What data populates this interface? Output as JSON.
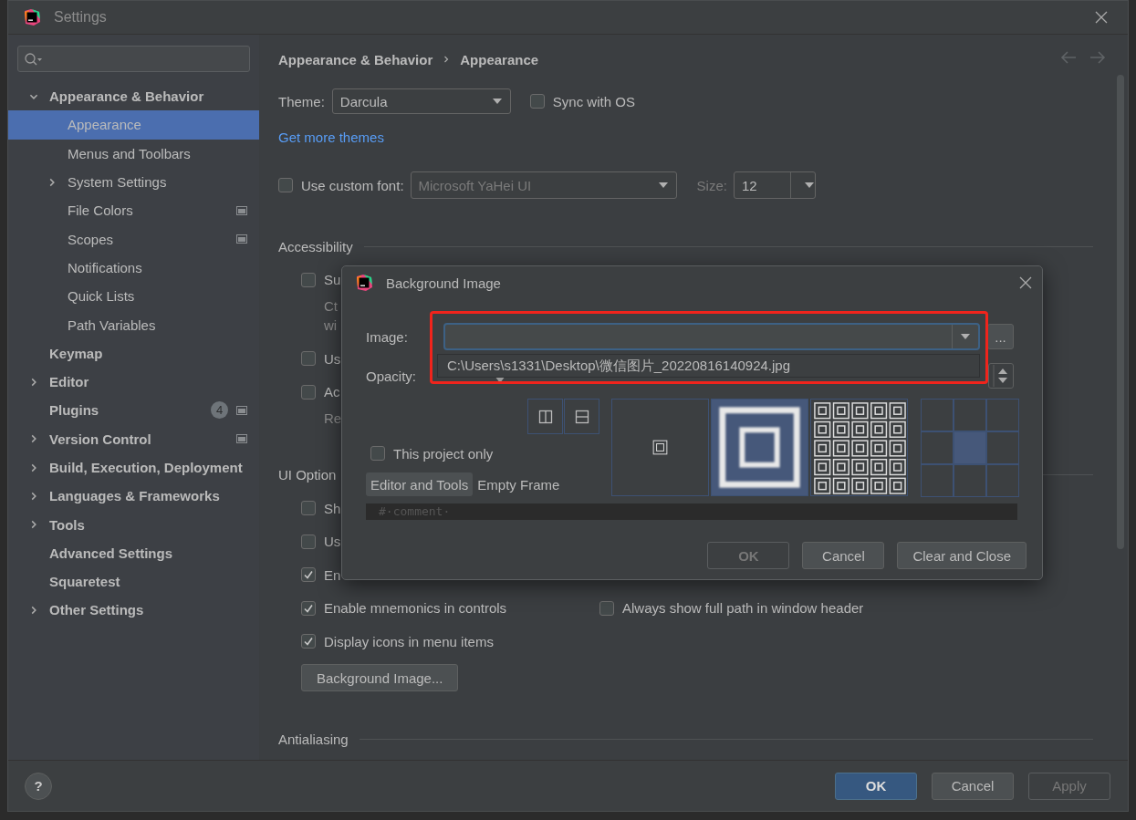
{
  "window": {
    "title": "Settings"
  },
  "sidebar": {
    "items": [
      {
        "label": "Appearance & Behavior",
        "expanded": true,
        "selected": false,
        "project_icon": false,
        "children": [
          {
            "label": "Appearance",
            "selected": true,
            "project_icon": false
          },
          {
            "label": "Menus and Toolbars",
            "selected": false,
            "project_icon": false
          },
          {
            "label": "System Settings",
            "expanded": false,
            "selected": false,
            "project_icon": false
          },
          {
            "label": "File Colors",
            "selected": false,
            "project_icon": true
          },
          {
            "label": "Scopes",
            "selected": false,
            "project_icon": true
          },
          {
            "label": "Notifications",
            "selected": false,
            "project_icon": false
          },
          {
            "label": "Quick Lists",
            "selected": false,
            "project_icon": false
          },
          {
            "label": "Path Variables",
            "selected": false,
            "project_icon": false
          }
        ]
      },
      {
        "label": "Keymap",
        "selected": false,
        "project_icon": false
      },
      {
        "label": "Editor",
        "expanded": false,
        "selected": false,
        "project_icon": false
      },
      {
        "label": "Plugins",
        "selected": false,
        "project_icon": true,
        "badge": "4"
      },
      {
        "label": "Version Control",
        "expanded": false,
        "selected": false,
        "project_icon": true
      },
      {
        "label": "Build, Execution, Deployment",
        "expanded": false,
        "selected": false,
        "project_icon": false
      },
      {
        "label": "Languages & Frameworks",
        "expanded": false,
        "selected": false,
        "project_icon": false
      },
      {
        "label": "Tools",
        "expanded": false,
        "selected": false,
        "project_icon": false
      },
      {
        "label": "Advanced Settings",
        "selected": false,
        "project_icon": false
      },
      {
        "label": "Squaretest",
        "selected": false,
        "project_icon": false
      },
      {
        "label": "Other Settings",
        "expanded": false,
        "selected": false,
        "project_icon": false
      }
    ]
  },
  "breadcrumb": [
    "Appearance & Behavior",
    "Appearance"
  ],
  "theme": {
    "label": "Theme:",
    "value": "Darcula"
  },
  "sync_with_os": {
    "label": "Sync with OS",
    "checked": false
  },
  "more_themes_link": "Get more themes",
  "custom_font": {
    "label": "Use custom font:",
    "checked": false,
    "value": "Microsoft YaHei UI",
    "disabled": true,
    "size_label": "Size:",
    "size": "12"
  },
  "sections": [
    {
      "title": "Accessibility",
      "options": [
        {
          "label": "Su",
          "checked": false,
          "notes": [
            "Ct",
            "wi"
          ]
        },
        {
          "label": "Us",
          "checked": false
        },
        {
          "label": "Ac",
          "checked": false,
          "notes": [
            "Re"
          ]
        }
      ]
    },
    {
      "title": "UI Option",
      "options": [
        {
          "label": "Sh",
          "checked": false
        },
        {
          "label": "Us",
          "checked": false
        },
        {
          "label": "En",
          "checked": true
        },
        {
          "label": "Enable mnemonics in controls",
          "checked": true,
          "side": {
            "label": "Always show full path in window header",
            "checked": false
          }
        },
        {
          "label": "Display icons in menu items",
          "checked": true
        }
      ],
      "button": "Background Image..."
    },
    {
      "title": "Antialiasing"
    }
  ],
  "footer": {
    "help": "?",
    "buttons": [
      {
        "label": "OK",
        "kind": "primary",
        "disabled": false
      },
      {
        "label": "Cancel",
        "kind": "normal",
        "disabled": false
      },
      {
        "label": "Apply",
        "kind": "normal",
        "disabled": true
      }
    ]
  },
  "dialog": {
    "title": "Background Image",
    "image_label": "Image:",
    "browse": "...",
    "popup_items": [
      "C:\\Users\\s1331\\Desktop\\微信图片_20220816140924.jpg"
    ],
    "opacity_label": "Opacity:",
    "this_project_only": {
      "label": "This project only",
      "checked": false
    },
    "targets": [
      {
        "label": "Editor and Tools",
        "selected": true
      },
      {
        "label": "Empty Frame",
        "selected": false
      }
    ],
    "fill_modes": [
      {
        "kind": "center",
        "selected": false
      },
      {
        "kind": "stretch",
        "selected": true
      },
      {
        "kind": "tile",
        "selected": false
      }
    ],
    "anchors": [
      {
        "selected": false
      },
      {
        "selected": false
      },
      {
        "selected": false
      },
      {
        "selected": false
      },
      {
        "selected": true
      },
      {
        "selected": false
      },
      {
        "selected": false
      },
      {
        "selected": false
      },
      {
        "selected": false
      }
    ],
    "preview_text": "#·comment·",
    "buttons": [
      {
        "label": "OK",
        "disabled": true
      },
      {
        "label": "Cancel",
        "disabled": false
      },
      {
        "label": "Clear and Close",
        "disabled": false
      }
    ]
  }
}
